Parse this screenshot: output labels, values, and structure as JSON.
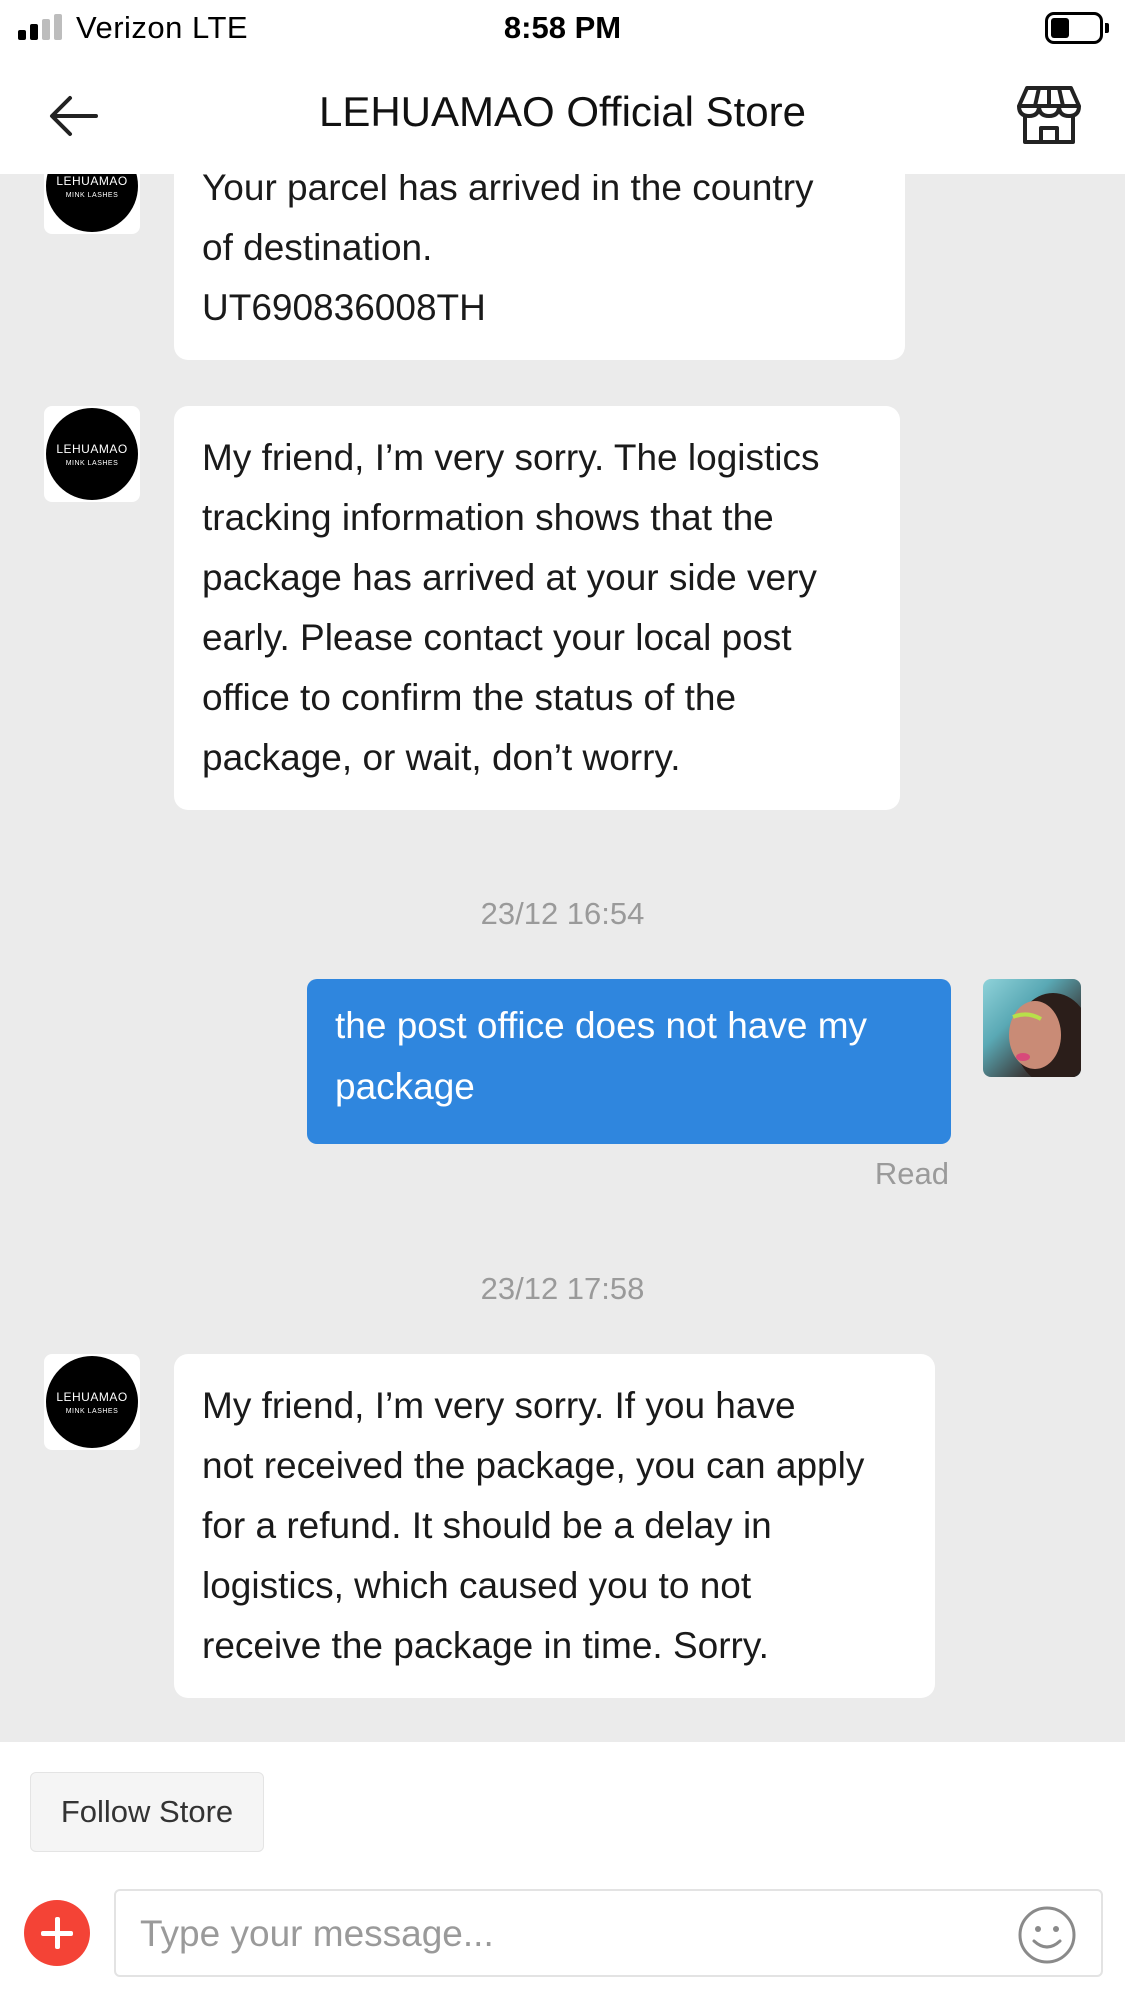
{
  "status_bar": {
    "carrier": "Verizon  LTE",
    "time": "8:58 PM"
  },
  "header": {
    "title": "LEHUAMAO Official Store"
  },
  "store_avatar": {
    "brand": "LEHUAMAO",
    "sub": "MINK LASHES"
  },
  "messages": [
    {
      "type": "received",
      "lines": [
        "Your parcel has arrived in the country",
        "of destination.",
        "UT690836008TH"
      ]
    },
    {
      "type": "received",
      "lines": [
        "My friend, I’m very sorry. The logistics",
        "tracking information shows that the",
        "package has arrived at your side very",
        "early. Please contact your local post",
        "office to confirm the status of the",
        "package, or wait, don’t worry."
      ]
    },
    {
      "type": "timestamp",
      "text": "23/12 16:54"
    },
    {
      "type": "sent",
      "lines": [
        "the post office does not have my",
        "package"
      ],
      "status": "Read"
    },
    {
      "type": "timestamp",
      "text": "23/12 17:58"
    },
    {
      "type": "received",
      "lines": [
        "My friend, I’m very sorry. If you have",
        "not received the package, you can apply",
        "for a refund. It should be a delay in",
        "logistics, which caused you to not",
        "receive the package in time. Sorry."
      ]
    }
  ],
  "bottom": {
    "follow_label": "Follow Store",
    "input_placeholder": "Type your message..."
  },
  "colors": {
    "sent_bubble": "#2f86de",
    "plus_button": "#f44336"
  },
  "icons": {
    "back": "back-arrow-icon",
    "store": "storefront-icon",
    "add": "plus-icon",
    "emoji": "smiley-icon"
  }
}
